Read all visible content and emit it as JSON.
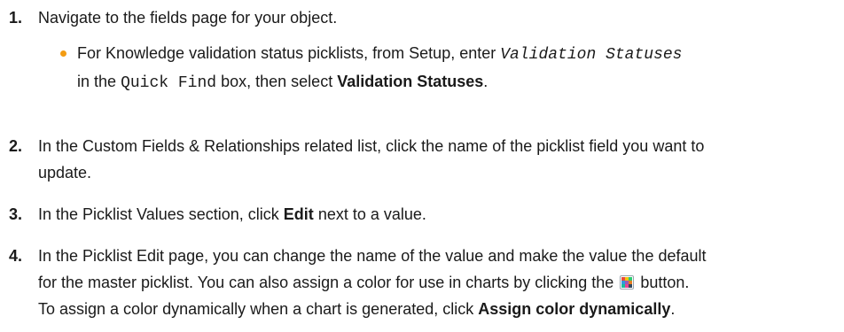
{
  "steps": [
    {
      "number": "1.",
      "text": "Navigate to the fields page for your object.",
      "bullet": {
        "pre": "For Knowledge validation status picklists, from Setup, enter",
        "code1": "Validation Statuses",
        "mid": "in the",
        "code2": "Quick Find",
        "post": "box, then select",
        "bold": "Validation Statuses",
        "end": "."
      }
    },
    {
      "number": "2.",
      "line1": "In the Custom Fields & Relationships related list, click the name of the picklist field you want to",
      "line2": "update."
    },
    {
      "number": "3.",
      "pre": "In the Picklist Values section, click",
      "bold": "Edit",
      "post": "next to a value."
    },
    {
      "number": "4.",
      "line1": "In the Picklist Edit page, you can change the name of the value and make the value the default",
      "line2_pre": "for the master picklist. You can also assign a color for use in charts by clicking the",
      "line2_post": "button.",
      "line3_pre": "To assign a color dynamically when a chart is generated, click",
      "line3_bold": "Assign color dynamically",
      "line3_end": "."
    }
  ],
  "icons": {
    "color_picker": "color-palette-icon"
  },
  "colors": {
    "bullet": "#f39c12",
    "text": "#1a1a1a"
  }
}
